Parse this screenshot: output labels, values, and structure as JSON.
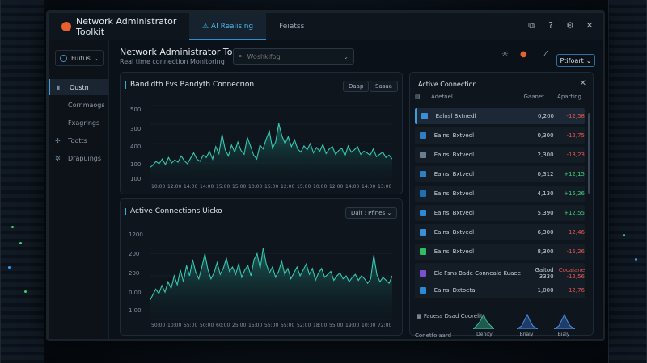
{
  "app": {
    "title": "Network Administrator Toolkit",
    "tabs": [
      "⚠ AI Realising",
      "Feiatss"
    ]
  },
  "sidebar": {
    "select_label": "Fuitus",
    "items": [
      {
        "label": "Oustn",
        "icon": "gauge-icon",
        "active": true
      },
      {
        "label": "Cornmaogs",
        "icon": "",
        "active": false
      },
      {
        "label": "Fxagrings",
        "icon": "",
        "active": false
      },
      {
        "label": "Tootts",
        "icon": "wrench-icon",
        "active": false
      },
      {
        "label": "Drapuings",
        "icon": "cog-icon",
        "active": false
      }
    ]
  },
  "header": {
    "title": "Network Administrator Toolkit",
    "subtitle": "Real time connection Monitoring",
    "search_placeholder": "Woshkifog",
    "profile_label": "Ptifoart"
  },
  "bandwidth": {
    "title": "Bandidth Fvs Bandyth Connecrion",
    "btn1": "Daap",
    "btn2": "Sasaa",
    "y_ticks": [
      "500",
      "300",
      "400",
      "100",
      "100"
    ],
    "x_ticks": [
      "10:00",
      "12:00",
      "14:00",
      "14:00",
      "15:00",
      "15:00",
      "10:00",
      "15:00",
      "12:00",
      "15:00",
      "10:00",
      "12:00",
      "14:00",
      "14:00",
      "13:00"
    ]
  },
  "active_chart": {
    "title": "Active Connections Uicko",
    "dropdown": "Dait : Pfines",
    "y_ticks": [
      "1200",
      "200",
      "200",
      "0.00",
      "1.00"
    ],
    "x_ticks": [
      "50:00",
      "10:00",
      "55:00",
      "50:00",
      "60:00",
      "25:00",
      "15:00",
      "55:00",
      "55:00",
      "52:00",
      "18:00",
      "55:00",
      "19:00",
      "10:00",
      "72:00"
    ]
  },
  "chart_data": [
    {
      "type": "area",
      "title": "Bandidth Fvs Bandyth Connecrion",
      "ylim": [
        0,
        500
      ],
      "values": [
        95,
        110,
        135,
        120,
        150,
        115,
        160,
        125,
        145,
        130,
        170,
        140,
        120,
        155,
        190,
        150,
        135,
        175,
        160,
        200,
        150,
        230,
        185,
        310,
        210,
        170,
        240,
        195,
        260,
        205,
        180,
        290,
        235,
        175,
        150,
        240,
        215,
        280,
        330,
        220,
        260,
        380,
        300,
        250,
        295,
        230,
        275,
        215,
        195,
        235,
        210,
        250,
        190,
        225,
        200,
        245,
        185,
        215,
        230,
        180,
        205,
        220,
        170,
        235,
        195,
        210,
        230,
        180,
        200,
        190,
        175,
        215,
        165,
        180,
        195,
        160,
        175,
        150
      ]
    },
    {
      "type": "area",
      "title": "Active Connections Uicko",
      "ylim": [
        0,
        1200
      ],
      "values": [
        260,
        340,
        420,
        360,
        470,
        380,
        520,
        430,
        600,
        480,
        680,
        520,
        740,
        600,
        820,
        650,
        560,
        720,
        900,
        680,
        560,
        640,
        780,
        620,
        700,
        840,
        660,
        720,
        620,
        760,
        580,
        680,
        740,
        600,
        820,
        900,
        700,
        980,
        760,
        640,
        720,
        580,
        660,
        800,
        620,
        700,
        560,
        640,
        720,
        600,
        680,
        760,
        620,
        700,
        540,
        640,
        700,
        580,
        620,
        660,
        540,
        600,
        640,
        560,
        600,
        520,
        580,
        620,
        540,
        600,
        560,
        500,
        560,
        880,
        620,
        520,
        580,
        540,
        500,
        600
      ]
    }
  ],
  "connections": {
    "title": "Active Connection",
    "columns": [
      "Adetnel",
      "Gaanet",
      "Aparting"
    ],
    "rows": [
      {
        "name": "Ealnsl Bxtnedl",
        "value": "0,200",
        "change": "-12,58",
        "dir": "neg",
        "color": "#3a8fd6",
        "selected": true
      },
      {
        "name": "Ealnsl Bxtvedl",
        "value": "0,300",
        "change": "-12,75",
        "dir": "neg",
        "color": "#2f7fc4",
        "selected": false
      },
      {
        "name": "Ealnsl Bxtvedl",
        "value": "2,300",
        "change": "-13,23",
        "dir": "neg",
        "color": "#6c7d92",
        "selected": false
      },
      {
        "name": "Ealnsl Bxtvedl",
        "value": "0,312",
        "change": "+12,15",
        "dir": "pos",
        "color": "#2f7fc4",
        "selected": false
      },
      {
        "name": "Ealnsl Bxtvedl",
        "value": "4,130",
        "change": "+15,26",
        "dir": "pos",
        "color": "#1f6fb3",
        "selected": false
      },
      {
        "name": "Ealnsl Bxtvedl",
        "value": "5,390",
        "change": "+12,55",
        "dir": "pos",
        "color": "#2a8ad6",
        "selected": false
      },
      {
        "name": "Ealnsl Bxtvedl",
        "value": "6,300",
        "change": "-12,46",
        "dir": "neg",
        "color": "#3a8fd6",
        "selected": false
      },
      {
        "name": "Ealnsl Bxtvedl",
        "value": "8,300",
        "change": "-15,26",
        "dir": "neg",
        "color": "#2dbf63",
        "selected": false
      },
      {
        "name": "Elc Fsns Bade Conneald Kuaee",
        "value": "Gaitod 3330",
        "change": "Cocaiane -12,56",
        "dir": "neg",
        "color": "#7b4fd0",
        "selected": false
      },
      {
        "name": "Ealnsl Dxtoeta",
        "value": "1,000",
        "change": "-12,76",
        "dir": "neg",
        "color": "#2a8ad6",
        "selected": false
      }
    ],
    "footer_title": "Faoess Dsad Coorelit",
    "footer_sub": "Conetfoiaard",
    "mini_labels": [
      "Denity",
      "Bnaly",
      "Bialy"
    ]
  }
}
